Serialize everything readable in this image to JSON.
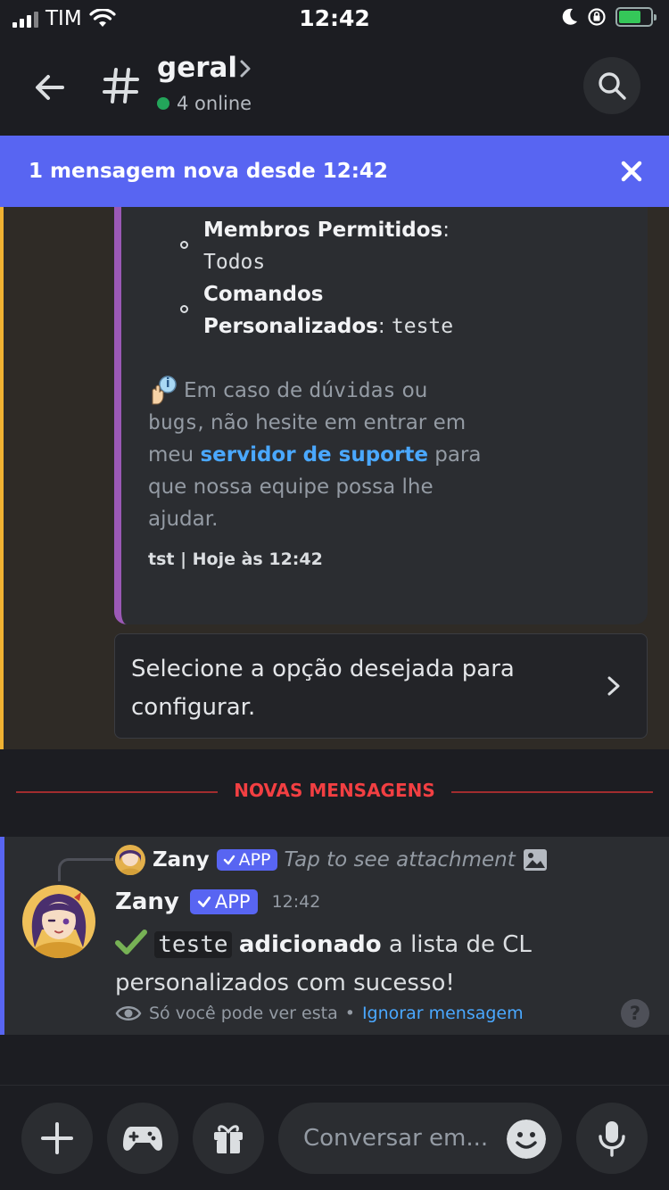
{
  "status_bar": {
    "carrier": "TIM",
    "time": "12:42"
  },
  "header": {
    "channel_name": "geral",
    "online_text": "4 online"
  },
  "banner": {
    "text": "1 mensagem nova desde 12:42"
  },
  "embed": {
    "line_todos_1": "Todos",
    "members_label": "Membros Permitidos",
    "members_colon": ":",
    "line_todos_2": "Todos",
    "commands_label_1": "Comandos",
    "commands_label_2": "Personalizados",
    "commands_colon": ":",
    "commands_value": "teste",
    "help_1a": "Em caso de ",
    "help_1b": "dúvidas",
    "help_1c": " ou",
    "help_2a": "bugs",
    "help_2b": ", não hesite em entrar em",
    "help_3a": "meu ",
    "help_3_link": "servidor de suporte",
    "help_3b": " para",
    "help_4": "que nossa equipe possa lhe",
    "help_5": "ajudar.",
    "footer": "tst | Hoje às 12:42"
  },
  "select": {
    "placeholder": "Selecione a opção desejada para configurar."
  },
  "divider": {
    "label": "NOVAS MENSAGENS"
  },
  "message": {
    "reply_author": "Zany",
    "reply_badge": "APP",
    "reply_hint": "Tap to see attachment",
    "author": "Zany",
    "badge": "APP",
    "time": "12:42",
    "body_code": "teste",
    "body_bold": "adicionado",
    "body_rest_1": " a lista de CL",
    "body_rest_2": "personalizados com sucesso!",
    "foot_text": "Só você pode ver esta",
    "foot_sep": "•",
    "foot_link": "Ignorar mensagem",
    "help_icon": "?"
  },
  "composer": {
    "placeholder": "Conversar em..."
  },
  "icons": {
    "back": "back-arrow-icon",
    "hash": "hash-icon",
    "search": "search-icon",
    "close": "close-icon",
    "plus": "plus-icon",
    "game": "gamepad-icon",
    "gift": "gift-icon",
    "emoji": "emoji-icon",
    "mic": "microphone-icon"
  },
  "colors": {
    "accent": "#5865f2",
    "mention_bar": "#f0b232",
    "embed_bar": "#9b59b6",
    "new_messages": "#f23f42",
    "link": "#4aa8ff",
    "online": "#23a55a"
  }
}
